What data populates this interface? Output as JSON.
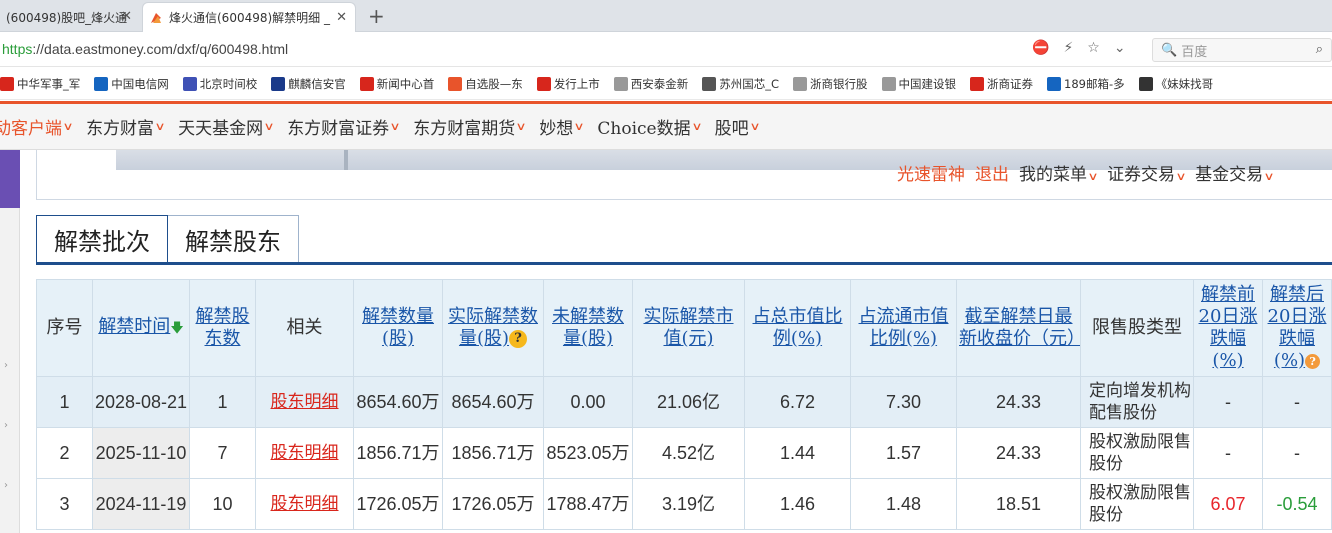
{
  "browser": {
    "tabs": [
      {
        "title": "(600498)股吧_烽火通",
        "active": false
      },
      {
        "title": "烽火通信(600498)解禁明细 _",
        "active": true
      }
    ],
    "url_scheme": "https",
    "url_rest": "://data.eastmoney.com/dxf/q/600498.html",
    "search_placeholder": "百度"
  },
  "bookmarks": [
    {
      "label": "中华军事_军",
      "icon": "china-military-icon",
      "color": "#d7261c"
    },
    {
      "label": "中国电信网",
      "icon": "telecom-icon",
      "color": "#1565c0"
    },
    {
      "label": "北京时间校",
      "icon": "clock-icon",
      "color": "#3f51b5"
    },
    {
      "label": "麒麟信安官",
      "icon": "kylin-icon",
      "color": "#1a3a8a"
    },
    {
      "label": "新闻中心首",
      "icon": "weibo-icon",
      "color": "#d7261c"
    },
    {
      "label": "自选股—东",
      "icon": "eastmoney-icon",
      "color": "#e8542b"
    },
    {
      "label": "发行上市",
      "icon": "listing-icon",
      "color": "#d7261c"
    },
    {
      "label": "西安泰金新",
      "icon": "page-icon",
      "color": "#999999"
    },
    {
      "label": "苏州国芯_C",
      "icon": "chip-icon",
      "color": "#555555"
    },
    {
      "label": "浙商银行股",
      "icon": "page-icon",
      "color": "#999999"
    },
    {
      "label": "中国建设银",
      "icon": "page-icon",
      "color": "#999999"
    },
    {
      "label": "浙商证券",
      "icon": "zheshang-icon",
      "color": "#d7261c"
    },
    {
      "label": "189邮箱-多",
      "icon": "mail-189-icon",
      "color": "#1565c0"
    },
    {
      "label": "《妹妹找哥",
      "icon": "bookmark-icon",
      "color": "#333333"
    }
  ],
  "sitenav": [
    {
      "label": "动客户端"
    },
    {
      "label": "东方财富"
    },
    {
      "label": "天天基金网"
    },
    {
      "label": "东方财富证券"
    },
    {
      "label": "东方财富期货"
    },
    {
      "label": "妙想"
    },
    {
      "label": "Choice数据"
    },
    {
      "label": "股吧"
    }
  ],
  "userlinks": {
    "name": "光速雷神",
    "logout": "退出",
    "menu": "我的菜单",
    "securities": "证券交易",
    "fund": "基金交易"
  },
  "subtabs": [
    "解禁批次",
    "解禁股东"
  ],
  "table": {
    "headers": {
      "seq": "序号",
      "time": "解禁时间",
      "holders": "解禁股东数",
      "related": "相关",
      "qty": "解禁数量(股)",
      "actual_qty": "实际解禁数量(股)",
      "unreleased": "未解禁数量(股)",
      "actual_mv": "实际解禁市值(元)",
      "pct_total": "占总市值比例(%)",
      "pct_float": "占流通市值比例(%)",
      "close": "截至解禁日最新收盘价（元）",
      "type": "限售股类型",
      "pre20": "解禁前20日涨跌幅(%)",
      "post20": "解禁后20日涨跌幅(%)"
    },
    "rows": [
      {
        "seq": "1",
        "time": "2028-08-21",
        "holders": "1",
        "related": "股东明细",
        "qty": "8654.60万",
        "actual_qty": "8654.60万",
        "unreleased": "0.00",
        "actual_mv": "21.06亿",
        "pct_total": "6.72",
        "pct_float": "7.30",
        "close": "24.33",
        "type": "定向增发机构配售股份",
        "pre20": "-",
        "post20": "-"
      },
      {
        "seq": "2",
        "time": "2025-11-10",
        "holders": "7",
        "related": "股东明细",
        "qty": "1856.71万",
        "actual_qty": "1856.71万",
        "unreleased": "8523.05万",
        "actual_mv": "4.52亿",
        "pct_total": "1.44",
        "pct_float": "1.57",
        "close": "24.33",
        "type": "股权激励限售股份",
        "pre20": "-",
        "post20": "-"
      },
      {
        "seq": "3",
        "time": "2024-11-19",
        "holders": "10",
        "related": "股东明细",
        "qty": "1726.05万",
        "actual_qty": "1726.05万",
        "unreleased": "1788.47万",
        "actual_mv": "3.19亿",
        "pct_total": "1.46",
        "pct_float": "1.48",
        "close": "18.51",
        "type": "股权激励限售股份",
        "pre20": "6.07",
        "post20": "-0.54"
      }
    ]
  },
  "colors": {
    "accent": "#e8542b",
    "link": "#1a56a8",
    "up": "#e8262c",
    "down": "#2a9d3a"
  }
}
